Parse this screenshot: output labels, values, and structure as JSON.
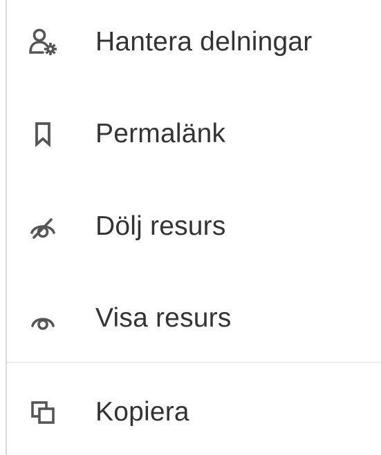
{
  "menu": {
    "items": [
      {
        "label": "Hantera delningar",
        "icon": "user-settings-icon"
      },
      {
        "label": "Permalänk",
        "icon": "bookmark-icon"
      },
      {
        "label": "Dölj resurs",
        "icon": "eye-off-icon"
      },
      {
        "label": "Visa resurs",
        "icon": "eye-icon"
      },
      {
        "label": "Kopiera",
        "icon": "copy-icon"
      }
    ]
  },
  "colors": {
    "icon": "#555555",
    "text": "#333333",
    "divider": "#ececec",
    "border": "#d9d9d9"
  }
}
